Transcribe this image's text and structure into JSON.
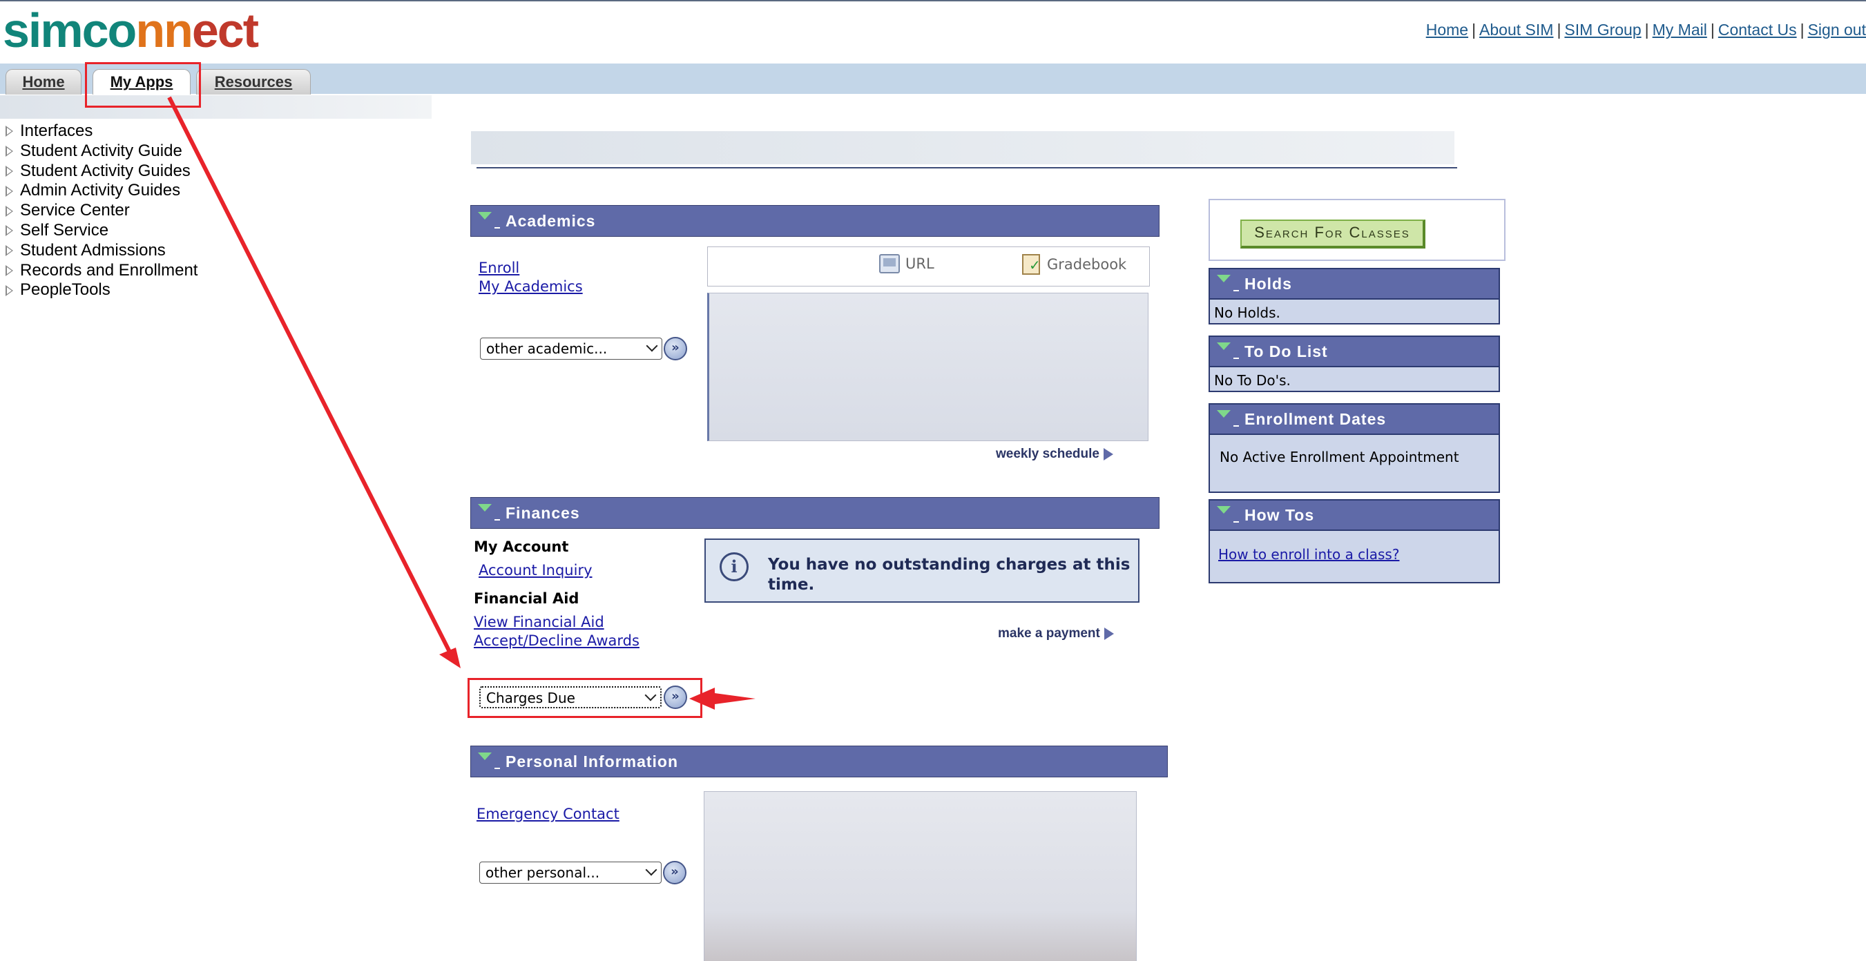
{
  "header": {
    "logo": {
      "part1": "simco",
      "part2": "nn",
      "part3": "ect"
    },
    "links": [
      "Home",
      "About SIM",
      "SIM Group",
      "My Mail",
      "Contact Us",
      "Sign out"
    ]
  },
  "tabs": [
    {
      "label": "Home",
      "active": false
    },
    {
      "label": "My Apps",
      "active": true
    },
    {
      "label": "Resources",
      "active": false
    }
  ],
  "nav": {
    "items": [
      "Interfaces",
      "Student Activity Guide",
      "Student Activity Guides",
      "Admin Activity Guides",
      "Service Center",
      "Self Service",
      "Student Admissions",
      "Records and Enrollment",
      "PeopleTools"
    ]
  },
  "academics": {
    "title": "Academics",
    "links": [
      "Enroll",
      "My Academics"
    ],
    "select": "other academic...",
    "toolbar": {
      "url_label": "URL",
      "gradebook_label": "Gradebook"
    },
    "weekly_schedule": "weekly schedule"
  },
  "finances": {
    "title": "Finances",
    "my_account_label": "My Account",
    "account_inquiry": "Account Inquiry",
    "financial_aid_label": "Financial Aid",
    "view_financial_aid": "View Financial Aid",
    "accept_decline": "Accept/Decline Awards",
    "notice_line1": "You have no outstanding charges at this",
    "notice_line2": "time.",
    "make_payment": "make a payment",
    "select": "Charges Due"
  },
  "personal": {
    "title": "Personal Information",
    "emergency_contact": "Emergency Contact",
    "select": "other personal..."
  },
  "right": {
    "search_button": "Search For Classes",
    "holds": {
      "title": "Holds",
      "text": "No Holds."
    },
    "todo": {
      "title": "To Do List",
      "text": "No To Do's."
    },
    "enrollment": {
      "title": "Enrollment Dates",
      "text": "No Active Enrollment Appointment"
    },
    "howtos": {
      "title": "How Tos",
      "link": "How to enroll into a class?"
    }
  },
  "colors": {
    "section_header": "#5f6aa8",
    "annotation_red": "#e8232a",
    "tab_strip": "#c3d6e8"
  }
}
